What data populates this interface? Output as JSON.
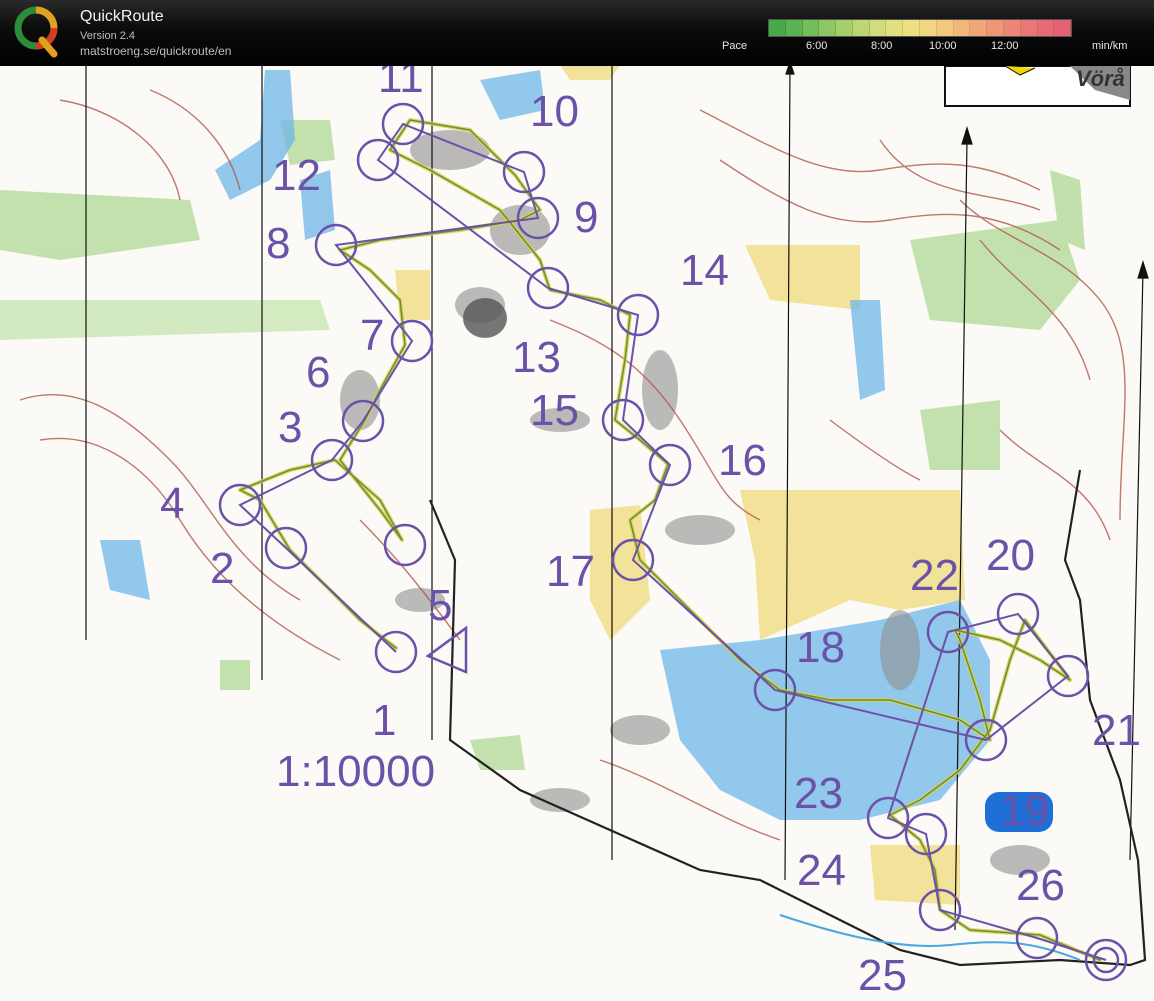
{
  "app": {
    "title": "QuickRoute",
    "version": "Version 2.4",
    "url": "matstroeng.se/quickroute/en"
  },
  "pace": {
    "label": "Pace",
    "unit": "min/km",
    "ticks": [
      "6:00",
      "8:00",
      "10:00",
      "12:00"
    ]
  },
  "map": {
    "scale_label": "1:10000",
    "inset_place": "Vörå",
    "control_labels": [
      "1",
      "2",
      "3",
      "4",
      "5",
      "6",
      "7",
      "8",
      "9",
      "10",
      "11",
      "12",
      "13",
      "14",
      "15",
      "16",
      "17",
      "18",
      "19",
      "20",
      "21",
      "22",
      "23",
      "24",
      "25",
      "26"
    ]
  },
  "colors": {
    "course": "#6b51a8",
    "route_yellow": "#d8d24a",
    "route_green": "#4c7b3e",
    "contour": "#b0584a",
    "water": "#4aa6e0",
    "open_land": "#f3e29a",
    "forest_green": "#b9dca0",
    "rock": "#9a9a9a"
  }
}
